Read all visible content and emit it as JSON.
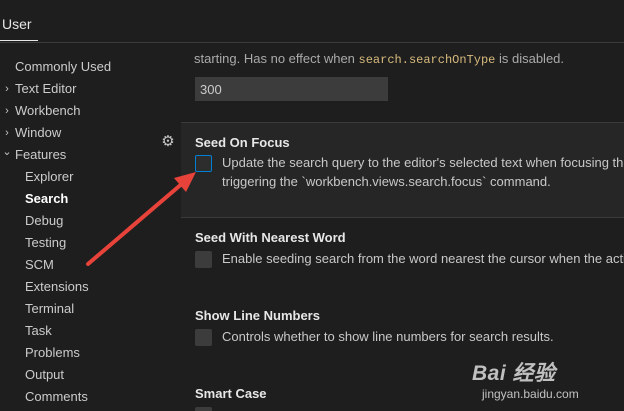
{
  "header": {
    "tab_user": "User"
  },
  "sidebar": {
    "items": [
      {
        "label": "Commonly Used",
        "chevron": ""
      },
      {
        "label": "Text Editor",
        "chevron": "›"
      },
      {
        "label": "Workbench",
        "chevron": "›"
      },
      {
        "label": "Window",
        "chevron": "›"
      },
      {
        "label": "Features",
        "chevron": "⌄"
      },
      {
        "label": "Explorer"
      },
      {
        "label": "Search",
        "active": true
      },
      {
        "label": "Debug"
      },
      {
        "label": "Testing"
      },
      {
        "label": "SCM"
      },
      {
        "label": "Extensions"
      },
      {
        "label": "Terminal"
      },
      {
        "label": "Task"
      },
      {
        "label": "Problems"
      },
      {
        "label": "Output"
      },
      {
        "label": "Comments"
      }
    ]
  },
  "main": {
    "prev_desc_prefix": "starting. Has no effect when ",
    "prev_desc_code": "search.searchOnType",
    "prev_desc_suffix": " is disabled.",
    "prev_value": "300",
    "settings": [
      {
        "title": "Seed On Focus",
        "desc_line1": "Update the search query to the editor's selected text when focusing the",
        "desc_line2": "triggering the `workbench.views.search.focus` command."
      },
      {
        "title": "Seed With Nearest Word",
        "desc_line1": "Enable seeding search from the word nearest the cursor when the active"
      },
      {
        "title": "Show Line Numbers",
        "desc_line1": "Controls whether to show line numbers for search results."
      },
      {
        "title": "Smart Case"
      }
    ]
  },
  "watermark": {
    "logo": "Bai 经验",
    "url": "jingyan.baidu.com"
  },
  "colors": {
    "background": "#1e1e1e",
    "focus_border": "#007fd4",
    "annotation_arrow": "#e8433a"
  }
}
